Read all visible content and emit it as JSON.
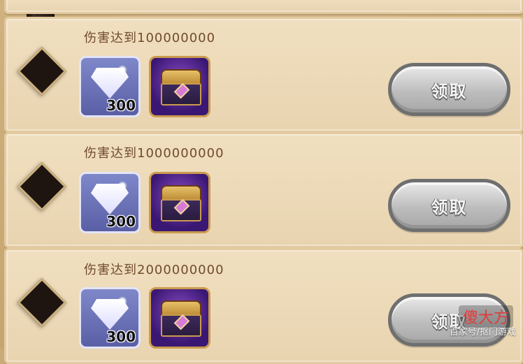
{
  "rewards": [
    {
      "title": "伤害达到100000000",
      "gem_qty": "300",
      "claim_label": "领取"
    },
    {
      "title": "伤害达到1000000000",
      "gem_qty": "300",
      "claim_label": "领取"
    },
    {
      "title": "伤害达到2000000000",
      "gem_qty": "300",
      "claim_label": "领取"
    }
  ],
  "watermark": {
    "source": "百家号/抠门游戏",
    "logo_text": "傻大方"
  },
  "icons": {
    "gem": "diamond-gem-icon",
    "chest": "treasure-chest-icon",
    "node": "progress-diamond-node"
  }
}
